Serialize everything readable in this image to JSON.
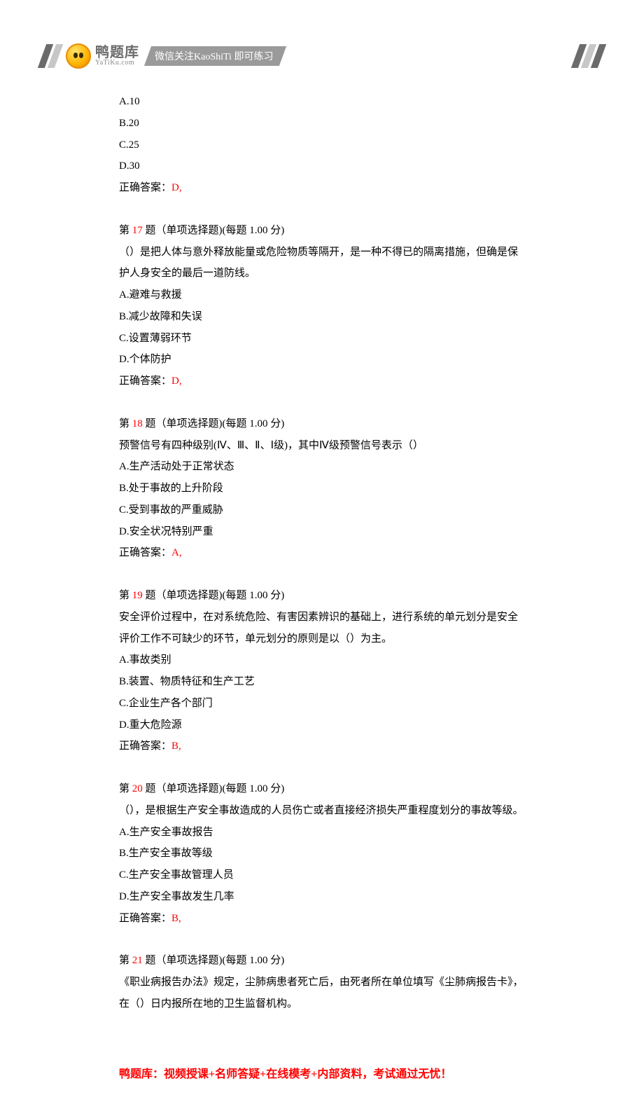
{
  "header": {
    "logo_cn": "鸭题库",
    "logo_en": "YaTiKu.com",
    "banner": "微信关注KaoShiTi 即可练习"
  },
  "partial": {
    "options": [
      "A.10",
      "B.20",
      "C.25",
      "D.30"
    ],
    "answer_label": "正确答案：",
    "answer_value": "D,"
  },
  "questions": [
    {
      "prefix": "第 ",
      "num": "17",
      "suffix": " 题（单项选择题)(每题 1.00 分)",
      "text": "（）是把人体与意外释放能量或危险物质等隔开，是一种不得已的隔离措施，但确是保护人身安全的最后一道防线。",
      "options": [
        "A.避难与救援",
        "B.减少故障和失误",
        "C.设置薄弱环节",
        "D.个体防护"
      ],
      "answer_label": "正确答案：",
      "answer_value": "D,"
    },
    {
      "prefix": "第 ",
      "num": "18",
      "suffix": " 题（单项选择题)(每题 1.00 分)",
      "text": "预警信号有四种级别(Ⅳ、Ⅲ、Ⅱ、Ⅰ级)，其中Ⅳ级预警信号表示（）",
      "options": [
        "A.生产活动处于正常状态",
        "B.处于事故的上升阶段",
        "C.受到事故的严重威胁",
        "D.安全状况特别严重"
      ],
      "answer_label": "正确答案：",
      "answer_value": "A,"
    },
    {
      "prefix": "第 ",
      "num": "19",
      "suffix": " 题（单项选择题)(每题 1.00 分)",
      "text": "安全评价过程中，在对系统危险、有害因素辨识的基础上，进行系统的单元划分是安全评价工作不可缺少的环节，单元划分的原则是以（）为主。",
      "options": [
        "A.事故类别",
        "B.装置、物质特征和生产工艺",
        "C.企业生产各个部门",
        "D.重大危险源"
      ],
      "answer_label": "正确答案：",
      "answer_value": "B,"
    },
    {
      "prefix": "第 ",
      "num": "20",
      "suffix": " 题（单项选择题)(每题 1.00 分)",
      "text": "（），是根据生产安全事故造成的人员伤亡或者直接经济损失严重程度划分的事故等级。",
      "options": [
        "A.生产安全事故报告",
        "B.生产安全事故等级",
        "C.生产安全事故管理人员",
        "D.生产安全事故发生几率"
      ],
      "answer_label": "正确答案：",
      "answer_value": "B,"
    },
    {
      "prefix": "第 ",
      "num": "21",
      "suffix": " 题（单项选择题)(每题 1.00 分)",
      "text": "《职业病报告办法》规定，尘肺病患者死亡后，由死者所在单位填写《尘肺病报告卡》，在（）日内报所在地的卫生监督机构。",
      "options": [],
      "answer_label": "",
      "answer_value": ""
    }
  ],
  "footer": "鸭题库：视频授课+名师答疑+在线模考+内部资料，考试通过无忧！"
}
